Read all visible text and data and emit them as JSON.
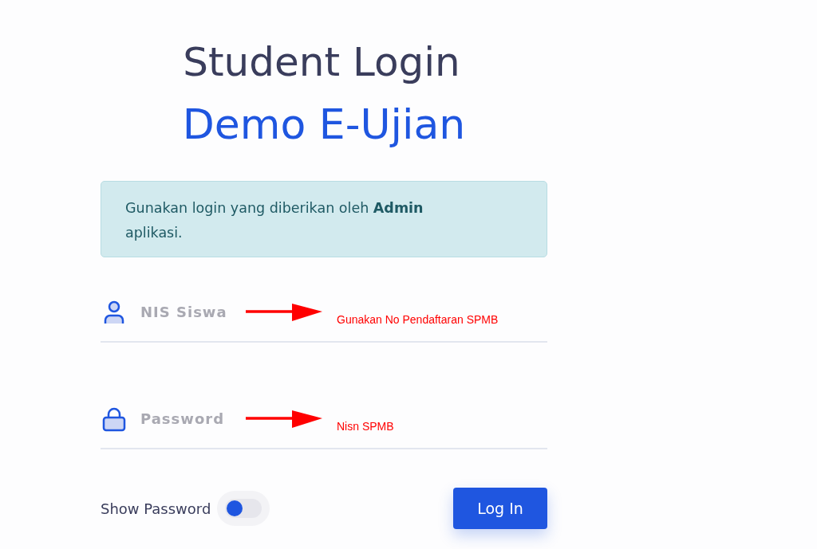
{
  "header": {
    "title": "Student Login",
    "subtitle": "Demo E-Ujian"
  },
  "notice": "Gunakan login yang diberikan oleh **Admin** aplikasi.",
  "fields": [
    {
      "kind": "user",
      "placeholder": "NIS Siswa",
      "annotation": "Gunakan No Pendaftaran SPMB"
    },
    {
      "kind": "password",
      "placeholder": "Password",
      "annotation": "Nisn SPMB"
    }
  ],
  "show_password": {
    "label": "Show Password",
    "on": false
  },
  "login_button": "Log In"
}
